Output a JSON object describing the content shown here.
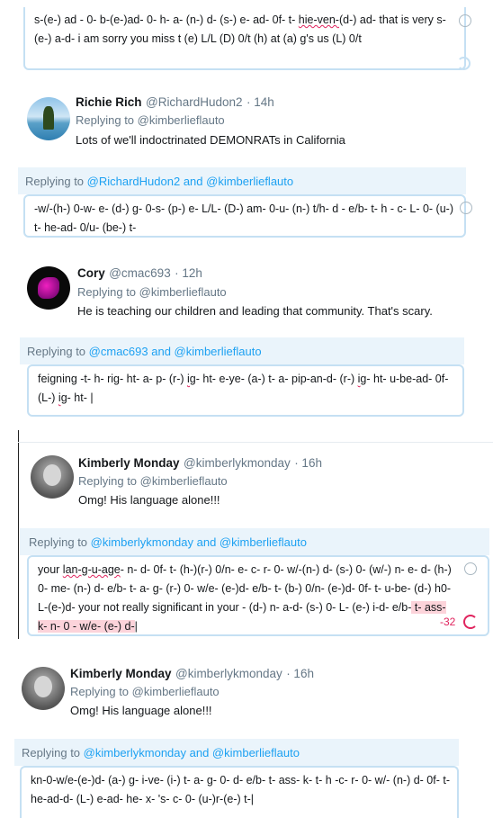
{
  "box1": {
    "segments": [
      {
        "t": "s-(e-) ad - 0- b-(e-)ad-  0- h- a- (n-) d- (s-) e- ad- 0f- t- ",
        "s": ""
      },
      {
        "t": "hie-ven-",
        "s": "squig"
      },
      {
        "t": "(d-) ad-   that is very s- (e-) a-d-   i am sorry you miss t (e) L/L (D) 0/t  (h) at (a) g's us (L) 0/t",
        "s": ""
      }
    ]
  },
  "tweet1": {
    "name": "Richie Rich",
    "handle": "@RichardHudon2",
    "time": "· 14h",
    "replying": "Replying to @kimberlieflauto",
    "body": "Lots of we'll indoctrinated DEMONRATs in California"
  },
  "reply1": {
    "label": "Replying to",
    "handles": "@RichardHudon2 and @kimberlieflauto"
  },
  "box2": {
    "segments": [
      {
        "t": "-w/-(h-)  0-w-  e- (d-) g- 0-s- (p-) e- L/L- (D-) am- 0-u- (n-) t/h- d - e/b- t- h - c- L- 0- (u-) t- he-ad- 0/u- (be-) t-",
        "s": ""
      }
    ]
  },
  "tweet2": {
    "name": "Cory",
    "handle": "@cmac693",
    "time": "· 12h",
    "replying": "Replying to @kimberlieflauto",
    "body": "He is teaching our children and leading that community.  That's scary."
  },
  "reply2": {
    "label": "Replying to",
    "handles": "@cmac693 and @kimberlieflauto"
  },
  "box3": {
    "segments": [
      {
        "t": "feigning -t- h- rig- ht- a- p- (r-) ",
        "s": ""
      },
      {
        "t": "ig",
        "s": "squig"
      },
      {
        "t": "- ht- e-ye- (a-) t- a- pip-an-d- (r-) ",
        "s": ""
      },
      {
        "t": "ig",
        "s": "squig"
      },
      {
        "t": "- ht-  u-be-ad- 0f- (L-) ",
        "s": ""
      },
      {
        "t": "ig",
        "s": "squig"
      },
      {
        "t": "- ht- |",
        "s": ""
      }
    ]
  },
  "tweet3": {
    "name": "Kimberly Monday",
    "handle": "@kimberlykmonday",
    "time": "· 16h",
    "replying": "Replying to @kimberlieflauto",
    "body": "Omg! His language alone!!!"
  },
  "reply3": {
    "label": "Replying to",
    "handles": "@kimberlykmonday and @kimberlieflauto"
  },
  "box4": {
    "segments": [
      {
        "t": "your ",
        "s": ""
      },
      {
        "t": "lan-g-u-age",
        "s": "squig"
      },
      {
        "t": "- n- d- 0f- t- (h-)(r-) 0/n- e- c- r- 0- w/-(n-) d- (s-) 0- (w/-) n- e- d- (h-) 0- me- (n-) d- e/b- t- a- g- (r-) 0- w/e- (e-)d- e/b- t- (b-) 0/n- (e-)d-  0f- t- u-be- (d-) h0- L-(e-)d-   your not really significant in your - (d-) n- a-d- (s-) 0- L- (e-) i-d- e/b-",
        "s": ""
      },
      {
        "t": " t- ass- k- n- 0 - w/e- (e-) d-",
        "s": "hl"
      },
      {
        "t": "|",
        "s": ""
      }
    ],
    "counter": "-32"
  },
  "tweet4": {
    "name": "Kimberly Monday",
    "handle": "@kimberlykmonday",
    "time": "· 16h",
    "replying": "Replying to @kimberlieflauto",
    "body": "Omg! His language alone!!!"
  },
  "reply4": {
    "label": "Replying to",
    "handles": "@kimberlykmonday and @kimberlieflauto"
  },
  "box5": {
    "segments": [
      {
        "t": "kn-0-w/e-(e-)d- (a-) g- i-ve- (i-) t- a- g- 0- d- e/b- t- ass- k- t- h -c- r- 0- w/- (n-) d- 0f- t- he-ad-d- (L-) e-ad- he- x- 's- c- 0- (u-)r-(e-) t-|",
        "s": ""
      }
    ]
  }
}
